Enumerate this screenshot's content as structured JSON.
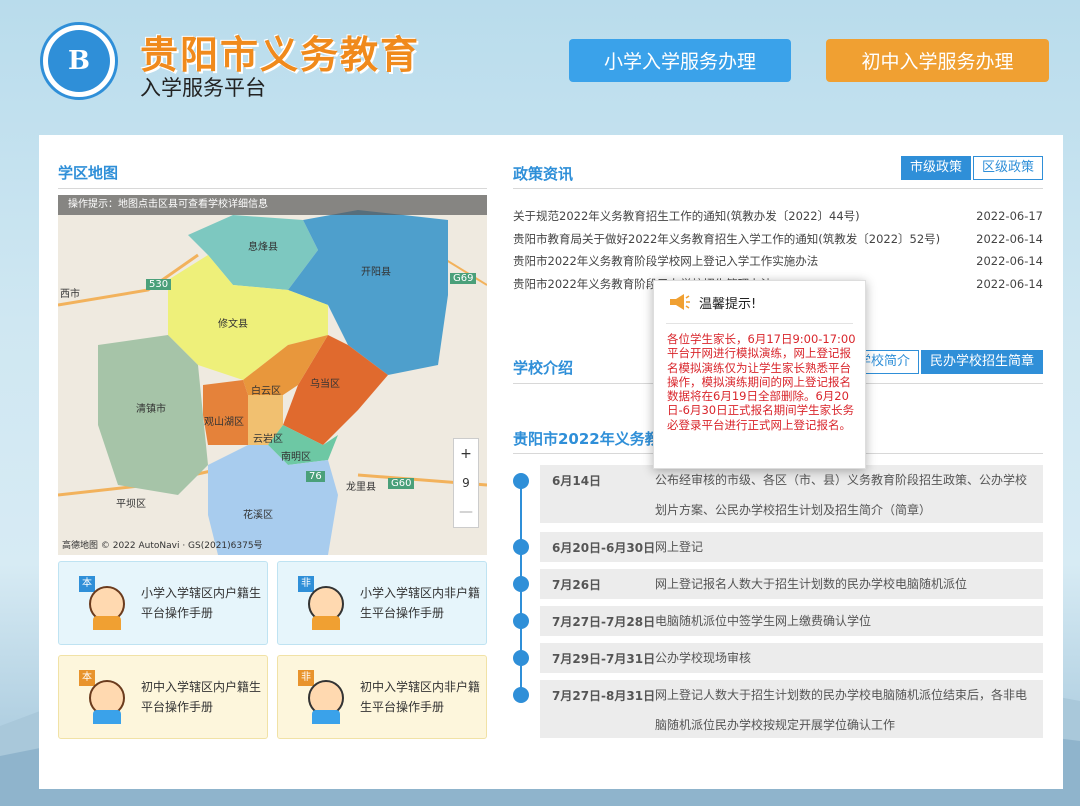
{
  "header": {
    "title": "贵阳市义务教育",
    "subtitle": "入学服务平台",
    "btn_primary": "小学入学服务办理",
    "btn_middle": "初中入学服务办理"
  },
  "map_section": {
    "title": "学区地图",
    "tip": "操作提示：地图点击区县可查看学校详细信息",
    "labels": [
      "息烽县",
      "开阳县",
      "修文县",
      "清镇市",
      "白云区",
      "乌当区",
      "观山湖区",
      "云岩区",
      "南明区",
      "花溪区",
      "龙里县",
      "平坝区",
      "西市"
    ],
    "road_labels": [
      "530",
      "G69",
      "G60",
      "76"
    ],
    "zoom_plus": "+",
    "zoom_level": "9",
    "zoom_minus": "—",
    "attribution": "高德地图 © 2022 AutoNavi · GS(2021)6375号"
  },
  "manuals": [
    {
      "badge": "本",
      "text": "小学入学辖区内户籍生平台操作手册",
      "color": "blue"
    },
    {
      "badge": "非",
      "text": "小学入学辖区内非户籍生平台操作手册",
      "color": "blue"
    },
    {
      "badge": "本",
      "text": "初中入学辖区内户籍生平台操作手册",
      "color": "yellow"
    },
    {
      "badge": "非",
      "text": "初中入学辖区内非户籍生平台操作手册",
      "color": "yellow"
    }
  ],
  "policy": {
    "title": "政策资讯",
    "tab_city": "市级政策",
    "tab_district": "区级政策",
    "items": [
      {
        "title": "关于规范2022年义务教育招生工作的通知(筑教办发〔2022〕44号)",
        "date": "2022-06-17"
      },
      {
        "title": "贵阳市教育局关于做好2022年义务教育招生入学工作的通知(筑教发〔2022〕52号)",
        "date": "2022-06-14"
      },
      {
        "title": "贵阳市2022年义务教育阶段学校网上登记入学工作实施办法",
        "date": "2022-06-14"
      },
      {
        "title": "贵阳市2022年义务教育阶段民办学校招生管理办法",
        "date": "2022-06-14"
      }
    ]
  },
  "school": {
    "title": "学校介绍",
    "tab_public": "学校简介",
    "tab_private": "民办学校招生简章"
  },
  "timeline": {
    "title": "贵阳市2022年义务教",
    "items": [
      {
        "date": "6月14日",
        "desc": "公布经审核的市级、各区（市、县）义务教育阶段招生政策、公办学校划片方案、公民办学校招生计划及招生简介（简章）"
      },
      {
        "date": "6月20日-6月30日",
        "desc": "网上登记"
      },
      {
        "date": "7月26日",
        "desc": "网上登记报名人数大于招生计划数的民办学校电脑随机派位"
      },
      {
        "date": "7月27日-7月28日",
        "desc": "电脑随机派位中签学生网上缴费确认学位"
      },
      {
        "date": "7月29日-7月31日",
        "desc": "公办学校现场审核"
      },
      {
        "date": "7月27日-8月31日",
        "desc": "网上登记人数大于招生计划数的民办学校电脑随机派位结束后，各非电脑随机派位民办学校按规定开展学位确认工作"
      }
    ]
  },
  "popup": {
    "title": "温馨提示!",
    "body": "各位学生家长，6月17日9:00-17:00平台开网进行模拟演练，网上登记报名模拟演练仅为让学生家长熟悉平台操作，模拟演练期间的网上登记报名数据将在6月19日全部删除。6月20日-6月30日正式报名期间学生家长务必登录平台进行正式网上登记报名。"
  },
  "colors": {
    "accent": "#2f8fd8",
    "orange": "#f08a1c",
    "alert": "#d9262c"
  }
}
